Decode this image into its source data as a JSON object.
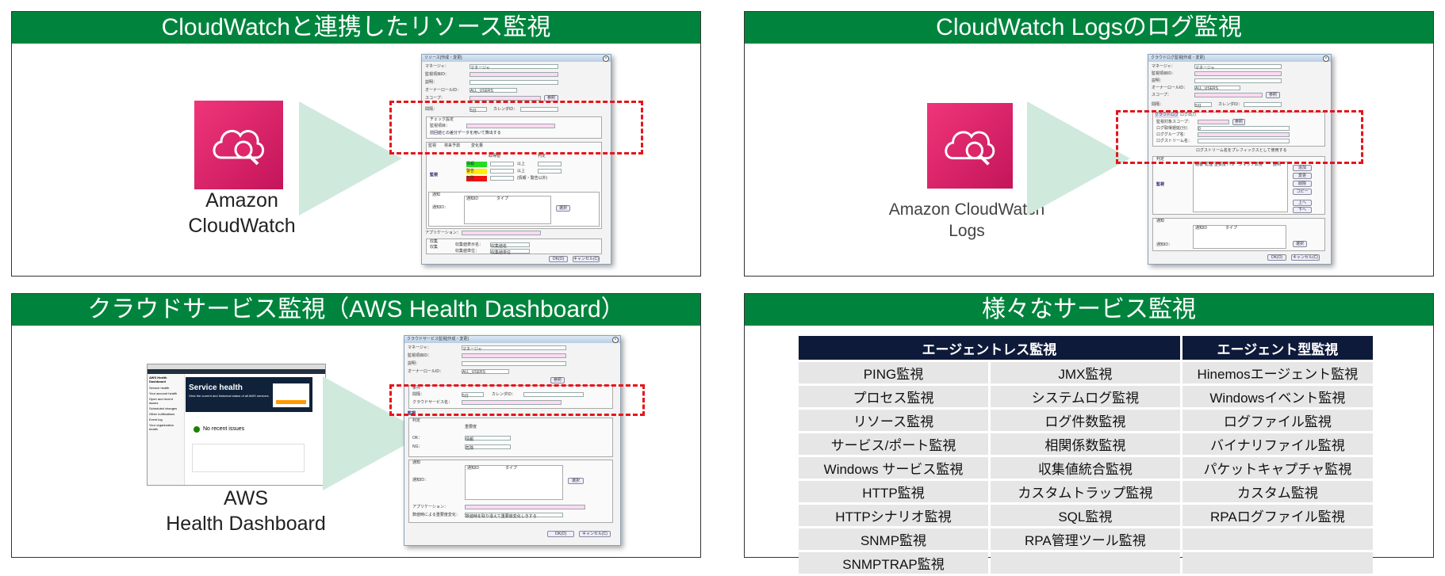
{
  "panels": {
    "tl_title": "CloudWatchと連携したリソース監視",
    "tr_title": "CloudWatch Logsのログ監視",
    "bl_title": "クラウドサービス監視（AWS Health Dashboard）",
    "br_title": "様々なサービス監視"
  },
  "captions": {
    "cloudwatch_line1": "Amazon",
    "cloudwatch_line2": "CloudWatch",
    "logs_line1": "Amazon CloudWatch",
    "logs_line2": "Logs",
    "aws_line1": "AWS",
    "aws_line2": "Health Dashboard"
  },
  "dialog_resource": {
    "title": "リソース[作成・変更]",
    "labels": [
      "マネージャ：",
      "監視項目ID：",
      "説明：",
      "オーナーロールID：",
      "スコープ："
    ],
    "manager_value": "マネージャ",
    "owner_value": "ALL_USERS",
    "ref_button": "参照",
    "interval_label": "間隔：",
    "interval_value": "5分",
    "calendar_label": "カレンダID：",
    "check_section": "チェック設定",
    "monitor_item_label": "監視項目：",
    "checkbox_label": "前回値との差分データを用いて算出する",
    "tabs": [
      "監視",
      "将来予測",
      "変化量"
    ],
    "monitor_check": "監視",
    "judge_headers": [
      "取得値",
      "判定"
    ],
    "judge_rows": [
      {
        "level": "情報",
        "color": "#22dd22",
        "unit": "以上"
      },
      {
        "level": "警告",
        "color": "#ffee00",
        "unit": "以上"
      },
      {
        "level": "危険",
        "color": "#ee1111",
        "unit": "(情報・警告以外)"
      }
    ],
    "notify_section": "通知",
    "notify_id_label": "通知ID：",
    "notify_headers": [
      "通知ID",
      "タイプ"
    ],
    "select_button": "選択",
    "app_label": "アプリケーション：",
    "collect_section": "収集",
    "collect_label": "収集",
    "collect_display_label": "収集値表示名：",
    "collect_display_value": "収集値名",
    "collect_unit_label": "収集値単位：",
    "collect_unit_value": "収集値単位",
    "ok_button": "OK(O)",
    "cancel_button": "キャンセル(C)"
  },
  "dialog_logs": {
    "title": "クラウドログ監視[作成・変更]",
    "labels": [
      "マネージャ：",
      "監視項目ID：",
      "説明：",
      "オーナーロールID：",
      "スコープ："
    ],
    "manager_value": "マネージャ",
    "owner_value": "ALL_USERS",
    "ref_button": "参照",
    "interval_label": "間隔：",
    "interval_value": "5分",
    "calendar_label": "カレンダID：",
    "tabs": [
      "クラウドログ",
      "ログ出力"
    ],
    "scope_label": "監視対象スコープ：",
    "region_label": "ログ取得遅延(分)：",
    "region_value": "0",
    "group_label": "ロググループ名：",
    "stream_label": "ログストリーム名：",
    "prefix_checkbox": "ログストリーム名をプレフィックスとして使用する",
    "judge_section": "判定",
    "judge_headers": [
      "順番",
      "処理",
      "重要度",
      "パターンマッチ表現",
      "説明"
    ],
    "side_buttons": [
      "追加",
      "変更",
      "削除",
      "コピー",
      "上へ",
      "下へ"
    ],
    "monitor_check": "監視",
    "notify_section": "通知",
    "notify_headers": [
      "通知ID",
      "タイプ"
    ],
    "notify_id_label": "通知ID：",
    "select_button": "選択",
    "ok_button": "OK(O)",
    "cancel_button": "キャンセル(C)"
  },
  "dialog_cloud": {
    "title": "クラウドサービス監視[作成・変更]",
    "labels": [
      "マネージャ：",
      "監視項目ID：",
      "説明：",
      "オーナーロールID："
    ],
    "manager_value": "マネージャ",
    "owner_value": "ALL_USERS",
    "ref_button": "参照",
    "cond_section": "条件",
    "interval_label": "間隔：",
    "interval_value": "5分",
    "calendar_label": "カレンダID：",
    "service_label": "クラウドサービス名：",
    "monitor_check": "監視",
    "judge_section": "判定",
    "severity_header": "重要度",
    "ok_label": "OK：",
    "ok_value": "情報",
    "ng_label": "NG：",
    "ng_value": "危険",
    "notify_section": "通知",
    "notify_id_label": "通知ID：",
    "notify_headers": [
      "通知ID",
      "タイプ"
    ],
    "select_button": "選択",
    "app_label": "アプリケーション：",
    "priority_label": "数値時による重要度変化：",
    "priority_value": "数値時を取り違えて重要度変化しきする",
    "ok_button": "OK(O)",
    "cancel_button": "キャンセル(C)"
  },
  "aws_screenshot": {
    "sidebar_title": "AWS Health Dashboard",
    "sidebar_items": [
      "Service health",
      "Your account health",
      "Open and recent issues",
      "Scheduled changes",
      "Other notifications",
      "Event log",
      "Your organization health"
    ],
    "banner_title": "Service health",
    "banner_text": "View the current and historical status of all AWS services.",
    "no_issues": "No recent issues"
  },
  "services": {
    "header_agentless": "エージェントレス監視",
    "header_agent": "エージェント型監視",
    "col1": [
      "PING監視",
      "プロセス監視",
      "リソース監視",
      "サービス/ポート監視",
      "Windows サービス監視",
      "HTTP監視",
      "HTTPシナリオ監視",
      "SNMP監視",
      "SNMPTRAP監視"
    ],
    "col2": [
      "JMX監視",
      "システムログ監視",
      "ログ件数監視",
      "相関係数監視",
      "収集値統合監視",
      "カスタムトラップ監視",
      "SQL監視",
      "RPA管理ツール監視",
      ""
    ],
    "col3": [
      "Hinemosエージェント監視",
      "Windowsイベント監視",
      "ログファイル監視",
      "バイナリファイル監視",
      "パケットキャプチャ監視",
      "カスタム監視",
      "RPAログファイル監視",
      "",
      ""
    ]
  },
  "colors": {
    "title_bar": "#00843d",
    "highlight": "#e5151b",
    "table_header": "#0e1a3a",
    "cloudwatch_icon": "#e0266a"
  },
  "icons": [
    "cloudwatch-icon",
    "cloudwatch-logs-icon"
  ]
}
